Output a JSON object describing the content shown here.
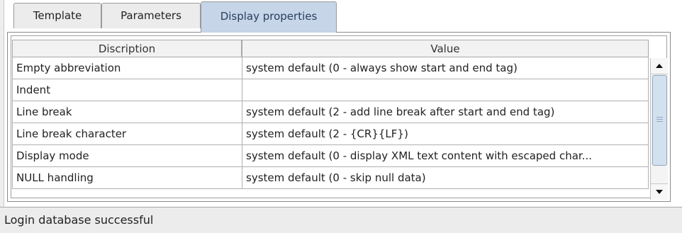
{
  "tabs": [
    {
      "label": "Template",
      "active": false
    },
    {
      "label": "Parameters",
      "active": false
    },
    {
      "label": "Display properties",
      "active": true
    }
  ],
  "table": {
    "headers": {
      "description": "Discription",
      "value": "Value"
    },
    "rows": [
      {
        "description": "Empty abbreviation",
        "value": "system default  (0 - always show start and end tag)"
      },
      {
        "description": "Indent",
        "value": ""
      },
      {
        "description": "Line break",
        "value": "system default  (2 - add line break after start and end tag)"
      },
      {
        "description": "Line break character",
        "value": "system default  (2 - {CR}{LF})"
      },
      {
        "description": "Display mode",
        "value": "system default  (0 - display XML text content with escaped char..."
      },
      {
        "description": "NULL handling",
        "value": "system default  (0 - skip null data)"
      }
    ]
  },
  "scrollbar": {
    "up_icon": "arrow-up-icon",
    "down_icon": "arrow-down-icon"
  },
  "status": {
    "text": "Login database successful"
  },
  "colors": {
    "active_tab": "#c6d5e8",
    "thumb": "#d3e1ef"
  }
}
